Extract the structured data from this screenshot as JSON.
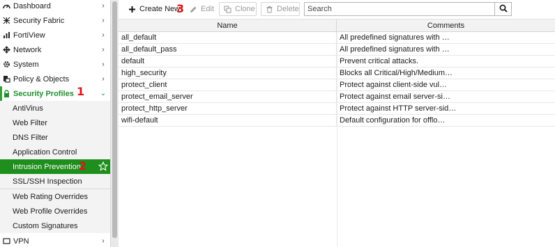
{
  "sidebar": {
    "items": [
      {
        "label": "Dashboard",
        "icon": "dashboard-icon",
        "chevron": "›"
      },
      {
        "label": "Security Fabric",
        "icon": "security-fabric-icon",
        "chevron": "›"
      },
      {
        "label": "FortiView",
        "icon": "fortiview-icon",
        "chevron": "›"
      },
      {
        "label": "Network",
        "icon": "network-icon",
        "chevron": "›"
      },
      {
        "label": "System",
        "icon": "gear-icon",
        "chevron": "›"
      },
      {
        "label": "Policy & Objects",
        "icon": "policy-icon",
        "chevron": "›"
      },
      {
        "label": "Security Profiles",
        "icon": "lock-icon",
        "chevron": "⌄"
      }
    ],
    "sub_items": [
      {
        "label": "AntiVirus"
      },
      {
        "label": "Web Filter"
      },
      {
        "label": "DNS Filter"
      },
      {
        "label": "Application Control"
      },
      {
        "label": "Intrusion Prevention"
      },
      {
        "label": "SSL/SSH Inspection"
      },
      {
        "label": "Web Rating Overrides"
      },
      {
        "label": "Web Profile Overrides"
      },
      {
        "label": "Custom Signatures"
      }
    ],
    "next_item": {
      "label": "VPN",
      "chevron": "›"
    }
  },
  "annotations": {
    "one": "1",
    "two": "2",
    "three": "3"
  },
  "toolbar": {
    "create_new": "Create New",
    "edit": "Edit",
    "clone": "Clone",
    "delete": "Delete",
    "search_placeholder": "Search"
  },
  "table": {
    "columns": [
      "Name",
      "Comments"
    ],
    "rows": [
      {
        "name": "all_default",
        "comments": "All predefined signatures with …"
      },
      {
        "name": "all_default_pass",
        "comments": "All predefined signatures with …"
      },
      {
        "name": "default",
        "comments": "Prevent critical attacks."
      },
      {
        "name": "high_security",
        "comments": "Blocks all Critical/High/Medium…"
      },
      {
        "name": "protect_client",
        "comments": "Protect against client-side vul…"
      },
      {
        "name": "protect_email_server",
        "comments": "Protect against email server-si…"
      },
      {
        "name": "protect_http_server",
        "comments": "Protect against HTTP server-sid…"
      },
      {
        "name": "wifi-default",
        "comments": "Default configuration for offlo…"
      }
    ]
  },
  "colors": {
    "accent_green": "#35a133",
    "selected_green": "#1e8e1c",
    "annotation_red": "#e0141a"
  }
}
